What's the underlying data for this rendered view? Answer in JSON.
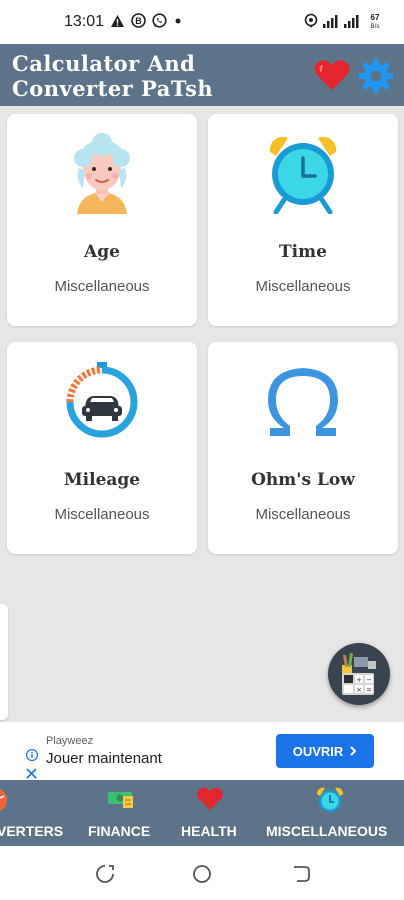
{
  "status_bar": {
    "time": "13:01",
    "left_icons": [
      "warning-icon",
      "b-badge-icon",
      "whatsapp-icon",
      "dot-icon"
    ],
    "right_icons": [
      "location-icon",
      "signal-icon",
      "signal-icon",
      "data-speed-icon"
    ],
    "data_speed": "67 B/s"
  },
  "app": {
    "title": "Calculator And Converter PaTsh",
    "favorite_icon": "heart-icon",
    "settings_icon": "gear-icon"
  },
  "cards": [
    {
      "title": "Age",
      "subtitle": "Miscellaneous",
      "icon": "elderly-woman-icon"
    },
    {
      "title": "Time",
      "subtitle": "Miscellaneous",
      "icon": "alarm-clock-icon"
    },
    {
      "title": "Mileage",
      "subtitle": "Miscellaneous",
      "icon": "car-speedometer-icon"
    },
    {
      "title": "Ohm's Low",
      "subtitle": "Miscellaneous",
      "icon": "omega-icon"
    }
  ],
  "fab": {
    "icon": "calculator-tools-icon"
  },
  "ad": {
    "sponsor": "Playweez",
    "headline": "Jouer maintenant",
    "cta": "OUVRIR",
    "cta_color": "#1a73e8"
  },
  "bottom_nav": [
    {
      "label": "VERTERS",
      "icon": "converters-icon"
    },
    {
      "label": "FINANCE",
      "icon": "finance-icon"
    },
    {
      "label": "HEALTH",
      "icon": "heart-icon"
    },
    {
      "label": "MISCELLANEOUS",
      "icon": "alarm-clock-icon"
    }
  ],
  "system_nav": [
    "recents-icon",
    "home-icon",
    "back-icon"
  ],
  "colors": {
    "header": "#5c7389",
    "background": "#e6e6e6",
    "heart": "#e3262d",
    "gear": "#2196f3"
  }
}
